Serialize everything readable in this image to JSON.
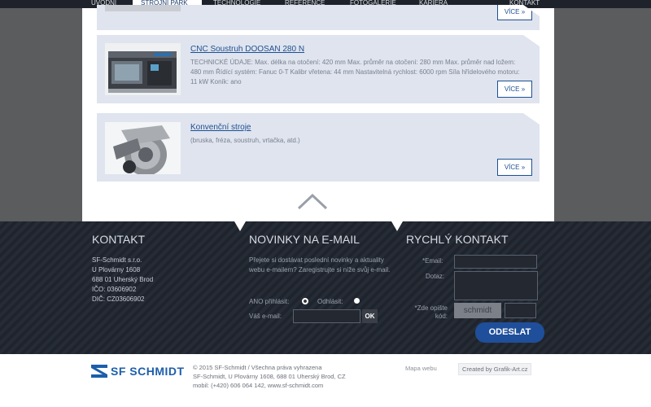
{
  "nav": {
    "items": [
      {
        "label": "ÚVODNÍ"
      },
      {
        "label": "STROJNÍ PARK"
      },
      {
        "label": "TECHNOLOGIE"
      },
      {
        "label": "REFERENCE"
      },
      {
        "label": "FOTOGALERIE"
      },
      {
        "label": "KARIÉRA"
      },
      {
        "label": "KONTAKT"
      }
    ]
  },
  "cards": [
    {
      "more_label": "VÍCE »"
    },
    {
      "title": "CNC Soustruh DOOSAN 280 N",
      "description": "TECHNICKÉ ÚDAJE: Max. délka na otočení: 420 mm Max. průměr na otočení: 280 mm Max. průměr nad ložem: 480 mm Řídící systém: Fanuc 0-T Kalibr vřetena: 44 mm Nastavitelná rychlost: 6000 rpm Síla hřídelového motoru: 11 kW Koník: ano",
      "more_label": "VÍCE »"
    },
    {
      "title": "Konvenční stroje",
      "description": "(bruska, fréza, soustruh, vrtačka, atd.)",
      "more_label": "VÍCE »"
    }
  ],
  "footer": {
    "contact": {
      "title": "KONTAKT",
      "lines": [
        "SF-Schmidt s.r.o.",
        "U Plovárny 1608",
        "688 01 Uherský Brod",
        "IČO: 03606902",
        "DIČ: CZ03606902"
      ]
    },
    "newsletter": {
      "title": "NOVINKY NA E-MAIL",
      "text": "Přejete si dostávat poslední novinky a aktuality webu e-mailem? Zaregistrujte si níže svůj e-mail.",
      "subscribe_label": "ANO přihlásit:",
      "unsubscribe_label": "Odhlásit:",
      "email_label": "Váš e-mail:",
      "ok_label": "OK"
    },
    "quick_contact": {
      "title": "RYCHLÝ KONTAKT",
      "email_label": "*Email:",
      "message_label": "Dotaz:",
      "captcha_label_1": "*Zde opište",
      "captcha_label_2": "kód:",
      "captcha_code": "schmidt",
      "send_label": "ODESLAT"
    }
  },
  "bottom": {
    "logo_text": "SF SCHMIDT",
    "copyright_lines": [
      "© 2015 SF-Schmidt / Všechna práva vyhrazena",
      "SF-Schmidt, U Plovárny 1608, 688 01 Uherský Brod, CZ",
      "mobil: (+420) 606 064 142, www.sf-schmidt.com"
    ],
    "sitemap_label": "Mapa webu",
    "credit_label": "Created by Grafik-Art.cz"
  },
  "colors": {
    "accent": "#1e4f93",
    "card_bg": "#dfe4ee",
    "footer_bg": "#242a33",
    "send_button": "#1f4f9a"
  }
}
